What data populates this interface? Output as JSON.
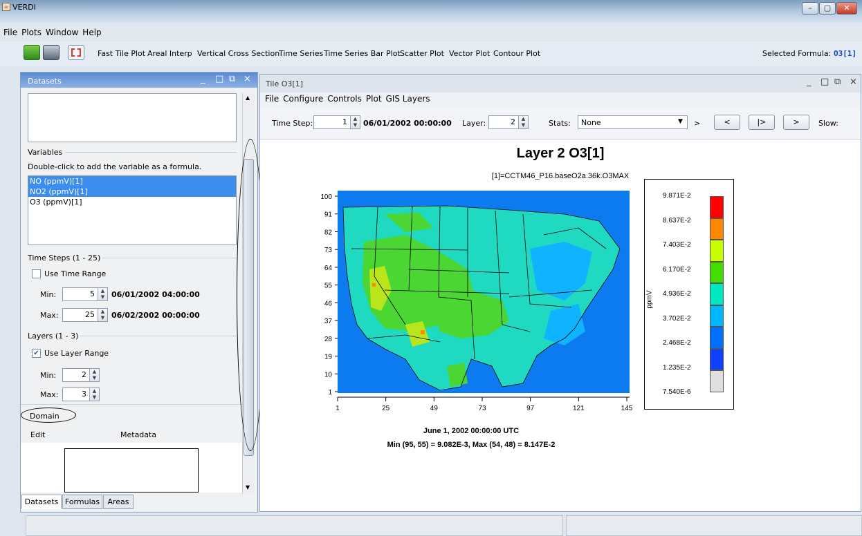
{
  "window": {
    "title": "VERDI"
  },
  "menubar": {
    "items": [
      "File",
      "Plots",
      "Window",
      "Help"
    ]
  },
  "toolbar": {
    "tools": [
      "Fast Tile Plot",
      "Areal Interp",
      "Vertical Cross Section",
      "Time Series",
      "Time Series Bar Plot",
      "Scatter Plot",
      "Vector Plot",
      "Contour Plot"
    ],
    "selected_formula_label": "Selected Formula:",
    "selected_formula_value": "O3[1]",
    "accent": "#1a3fd0"
  },
  "datasets_panel": {
    "title": "Datasets",
    "variables_heading": "Variables",
    "variables_hint": "Double-click to add the variable as a formula.",
    "variables": [
      "NO (ppmV)[1]",
      "NO2 (ppmV)[1]",
      "O3 (ppmV)[1]"
    ],
    "time_steps_heading": "Time Steps (1 - 25)",
    "use_time_range_label": "Use Time Range",
    "time_min_label": "Min:",
    "time_min_value": "5",
    "time_min_date": "06/01/2002 04:00:00",
    "time_max_label": "Max:",
    "time_max_value": "25",
    "time_max_date": "06/02/2002 00:00:00",
    "layers_heading": "Layers (1 - 3)",
    "use_layer_range_label": "Use Layer Range",
    "layer_min_label": "Min:",
    "layer_min_value": "2",
    "layer_max_label": "Max:",
    "layer_max_value": "3",
    "domain_heading": "Domain",
    "edit_label": "Edit",
    "metadata_label": "Metadata",
    "tabs": [
      "Datasets",
      "Formulas",
      "Areas"
    ]
  },
  "tile_panel": {
    "title": "Tile O3[1]",
    "menu": [
      "File",
      "Configure",
      "Controls",
      "Plot",
      "GIS Layers"
    ],
    "time_step_label": "Time Step:",
    "time_step_value": "1",
    "time_step_date": "06/01/2002 00:00:00",
    "layer_label": "Layer:",
    "layer_value": "2",
    "stats_label": "Stats:",
    "stats_value": "None",
    "gt_label": ">",
    "nav_prev": "<",
    "nav_play": "|>",
    "nav_next": ">",
    "slow_label": "Slow:"
  },
  "plot": {
    "title": "Layer 2 O3[1]",
    "subtitle": "[1]=CCTM46_P16.baseO2a.36k.O3MAX",
    "footer_date": "June 1, 2002 00:00:00 UTC",
    "footer_minmax": "Min (95, 55) = 9.082E-3, Max (54, 48) = 8.147E-2",
    "unit_label": "ppmV",
    "y_ticks": [
      "100",
      "91",
      "82",
      "73",
      "64",
      "55",
      "46",
      "37",
      "28",
      "19",
      "10",
      "1"
    ],
    "x_ticks": [
      "1",
      "25",
      "49",
      "73",
      "97",
      "121",
      "145"
    ],
    "legend_labels": [
      "9.871E-2",
      "8.637E-2",
      "7.403E-2",
      "6.170E-2",
      "4.936E-2",
      "3.702E-2",
      "2.468E-2",
      "1.235E-2",
      "7.540E-6"
    ],
    "legend_colors": [
      "#ff0000",
      "#ff8800",
      "#c8ff00",
      "#44dd00",
      "#00e8c0",
      "#00b8ff",
      "#0070ff",
      "#1040ff",
      "#e0e0e0"
    ]
  }
}
